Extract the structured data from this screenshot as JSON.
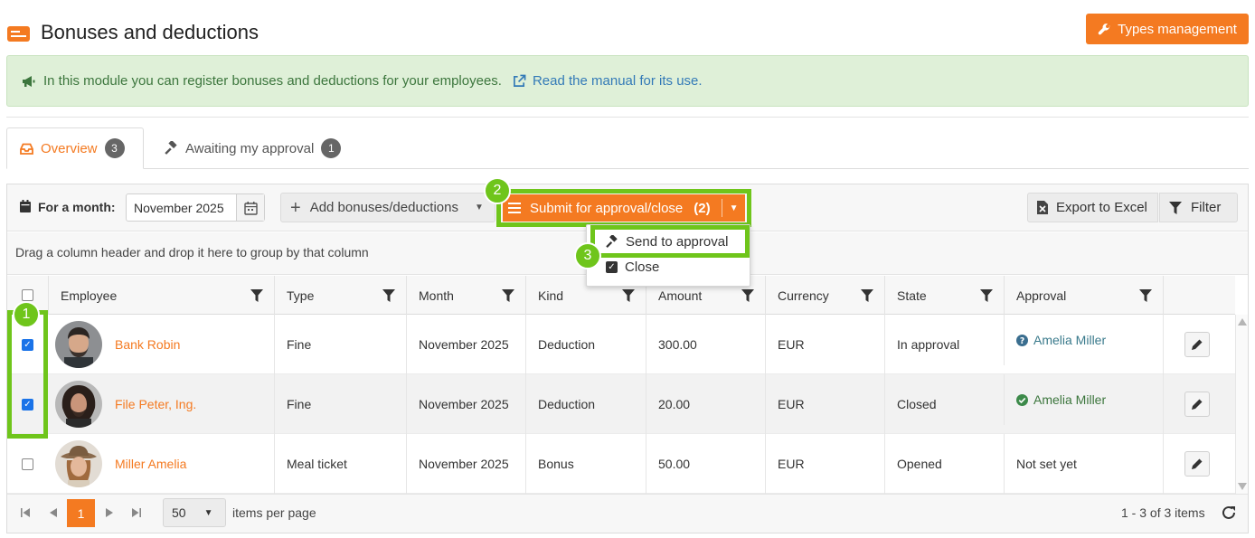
{
  "header": {
    "title": "Bonuses and deductions",
    "types_button": "Types management"
  },
  "info": {
    "text": "In this module you can register bonuses and deductions for your employees.",
    "link": "Read the manual for its use."
  },
  "tabs": [
    {
      "label": "Overview",
      "badge": "3"
    },
    {
      "label": "Awaiting my approval",
      "badge": "1"
    }
  ],
  "toolbar": {
    "month_label": "For a month:",
    "month_value": "November 2025",
    "add_button": "Add bonuses/deductions",
    "submit_button": "Submit for approval/close",
    "submit_count": "(2)",
    "export_button": "Export to Excel",
    "filter_button": "Filter"
  },
  "menu": {
    "send": "Send to approval",
    "close": "Close"
  },
  "markers": [
    "1",
    "2",
    "3"
  ],
  "group_hint": "Drag a column header and drop it here to group by that column",
  "columns": [
    "Employee",
    "Type",
    "Month",
    "Kind",
    "Amount",
    "Currency",
    "State",
    "Approval"
  ],
  "rows": [
    {
      "checked": true,
      "employee": "Bank Robin",
      "type": "Fine",
      "month": "November 2025",
      "kind": "Deduction",
      "amount": "300.00",
      "currency": "EUR",
      "state": "In approval",
      "approval": "Amelia Miller",
      "approval_icon": "question-circle-icon"
    },
    {
      "checked": true,
      "employee": "File Peter, Ing.",
      "type": "Fine",
      "month": "November 2025",
      "kind": "Deduction",
      "amount": "20.00",
      "currency": "EUR",
      "state": "Closed",
      "approval": "Amelia Miller",
      "approval_icon": "check-circle-icon"
    },
    {
      "checked": false,
      "employee": "Miller Amelia",
      "type": "Meal ticket",
      "month": "November 2025",
      "kind": "Bonus",
      "amount": "50.00",
      "currency": "EUR",
      "state": "Opened",
      "approval": "Not set yet",
      "approval_icon": ""
    }
  ],
  "pager": {
    "current_page": "1",
    "page_size": "50",
    "per_page_label": "items per page",
    "range": "1 - 3 of 3 items"
  },
  "colors": {
    "accent": "#f47a21",
    "highlight": "#6fc51b",
    "info_bg": "#dff0d8",
    "info_text": "#3c763d",
    "link": "#337ab7"
  }
}
